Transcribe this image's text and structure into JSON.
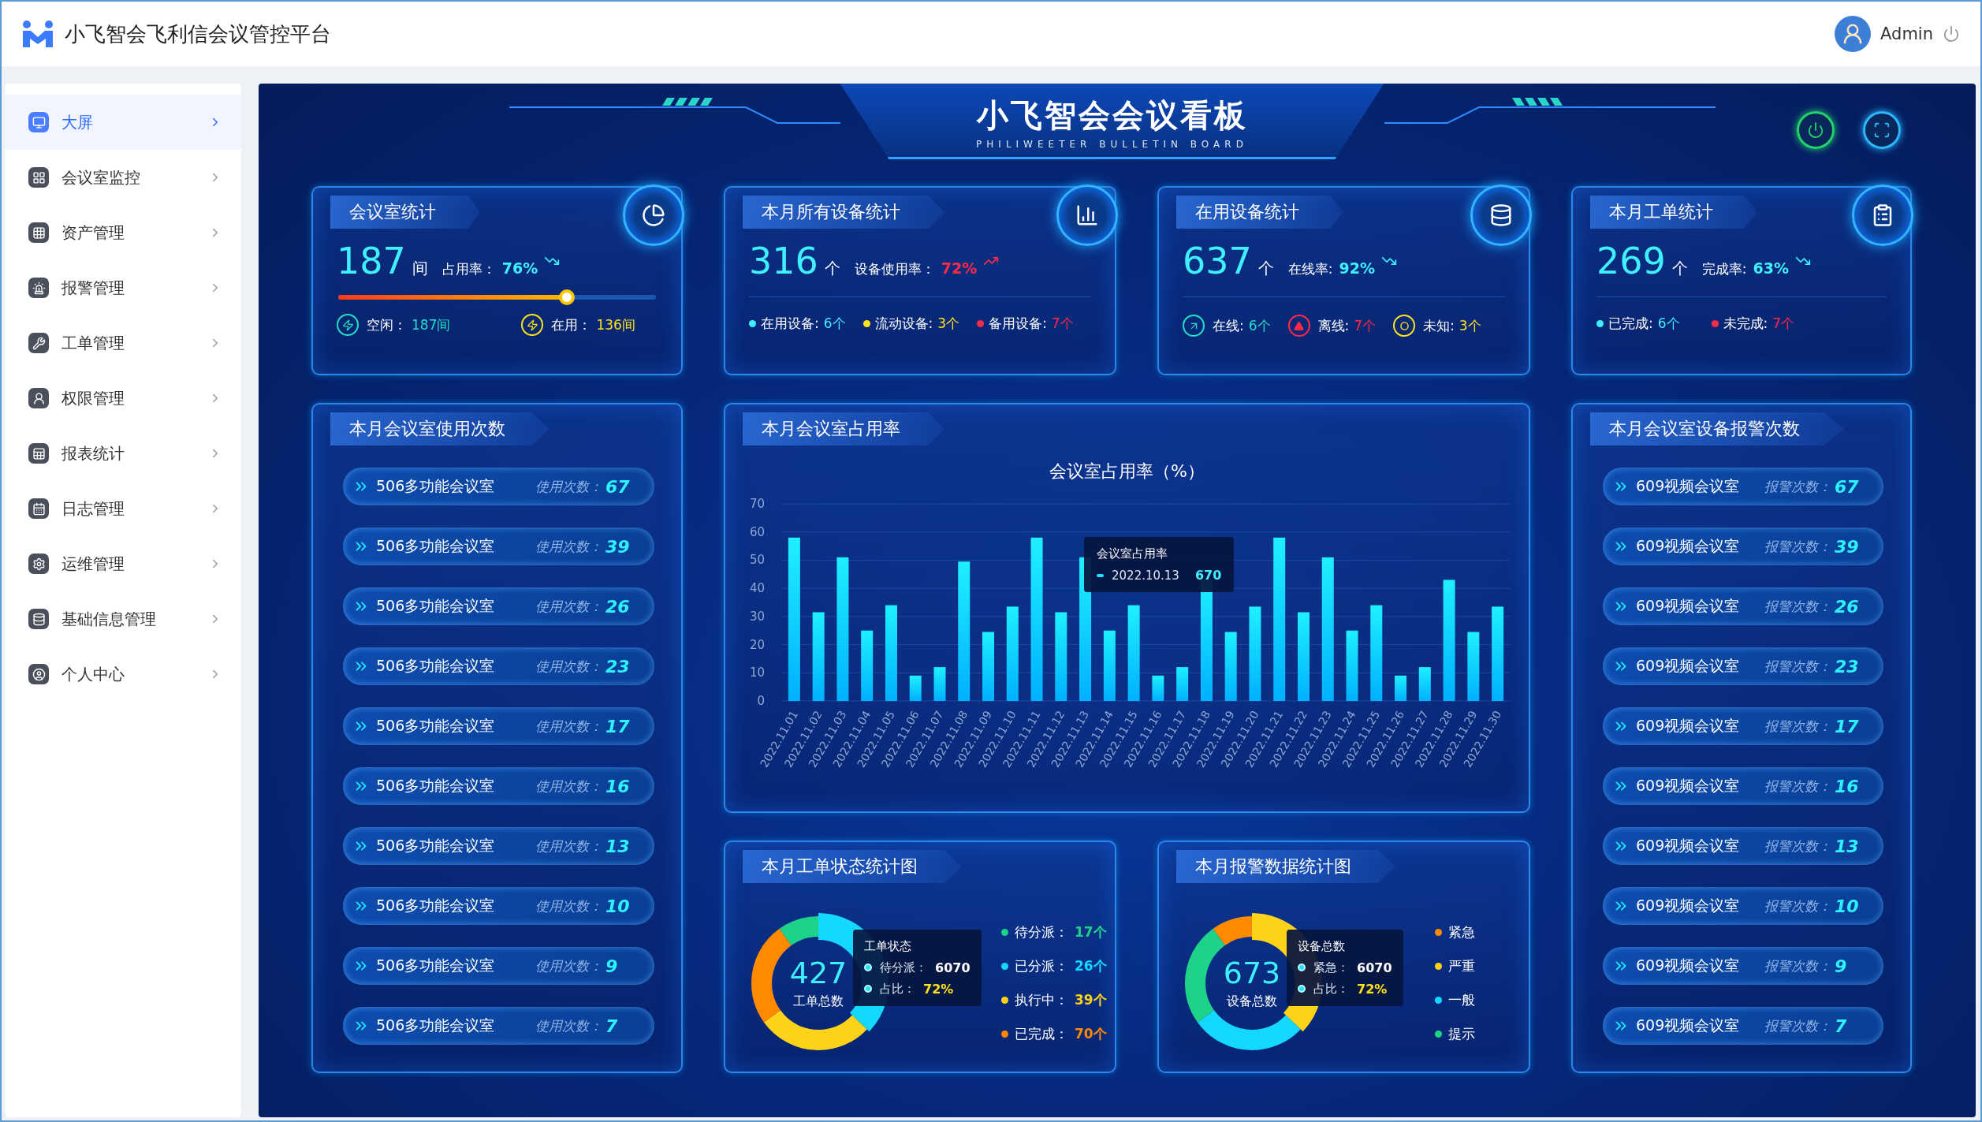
{
  "header": {
    "title": "小飞智会飞利信会议管控平台",
    "user": "Admin"
  },
  "sidebar": {
    "items": [
      {
        "label": "大屏",
        "selected": true
      },
      {
        "label": "会议室监控",
        "selected": false
      },
      {
        "label": "资产管理",
        "selected": false
      },
      {
        "label": "报警管理",
        "selected": false
      },
      {
        "label": "工单管理",
        "selected": false
      },
      {
        "label": "权限管理",
        "selected": false
      },
      {
        "label": "报表统计",
        "selected": false
      },
      {
        "label": "日志管理",
        "selected": false
      },
      {
        "label": "运维管理",
        "selected": false
      },
      {
        "label": "基础信息管理",
        "selected": false
      },
      {
        "label": "个人中心",
        "selected": false
      }
    ]
  },
  "board": {
    "title": "小飞智会会议看板",
    "subtitle": "PHILIWEETER BULLETIN BOARD"
  },
  "top_cards": [
    {
      "title": "会议室统计",
      "total": "187",
      "unit": "间",
      "rate_label": "占用率：",
      "rate": "76%",
      "rising": false,
      "color": "#3ff0ff",
      "slider": {
        "level": 0.72
      },
      "items": [
        {
          "kind": "bolt",
          "label": "空闲：",
          "value": "187间",
          "color": "#22e0c8"
        },
        {
          "kind": "bolt",
          "label": "在用：",
          "value": "136间",
          "color": "#ffe21a"
        }
      ]
    },
    {
      "title": "本月所有设备统计",
      "total": "316",
      "unit": "个",
      "rate_label": "设备使用率：",
      "rate": "72%",
      "rising": true,
      "color": "#ff2a4a",
      "items": [
        {
          "kind": "dot",
          "label": "在用设备:",
          "value": "6个",
          "color": "#3ff0ff"
        },
        {
          "kind": "dot",
          "label": "流动设备:",
          "value": "3个",
          "color": "#ffe21a"
        },
        {
          "kind": "dot",
          "label": "备用设备:",
          "value": "7个",
          "color": "#ff2a4a"
        }
      ]
    },
    {
      "title": "在用设备统计",
      "total": "637",
      "unit": "个",
      "rate_label": "在线率:",
      "rate": "92%",
      "rising": false,
      "color": "#3ff0ff",
      "items": [
        {
          "kind": "online",
          "label": "在线:",
          "value": "6个",
          "color": "#22e0c8"
        },
        {
          "kind": "offline",
          "label": "离线:",
          "value": "7个",
          "color": "#ff2a4a"
        },
        {
          "kind": "unknown",
          "label": "未知:",
          "value": "3个",
          "color": "#ffe21a"
        }
      ]
    },
    {
      "title": "本月工单统计",
      "total": "269",
      "unit": "个",
      "rate_label": "完成率:",
      "rate": "63%",
      "rising": false,
      "color": "#3ff0ff",
      "items": [
        {
          "kind": "dot",
          "label": "已完成:",
          "value": "6个",
          "color": "#3ff0ff"
        },
        {
          "kind": "dot",
          "label": "未完成:",
          "value": "7个",
          "color": "#ff2a4a"
        }
      ]
    }
  ],
  "usage_list": {
    "title": "本月会议室使用次数",
    "items": [
      {
        "name": "506多功能会议室",
        "label": "使用次数：",
        "count": "67"
      },
      {
        "name": "506多功能会议室",
        "label": "使用次数：",
        "count": "39"
      },
      {
        "name": "506多功能会议室",
        "label": "使用次数：",
        "count": "26"
      },
      {
        "name": "506多功能会议室",
        "label": "使用次数：",
        "count": "23"
      },
      {
        "name": "506多功能会议室",
        "label": "使用次数：",
        "count": "17"
      },
      {
        "name": "506多功能会议室",
        "label": "使用次数：",
        "count": "16"
      },
      {
        "name": "506多功能会议室",
        "label": "使用次数：",
        "count": "13"
      },
      {
        "name": "506多功能会议室",
        "label": "使用次数：",
        "count": "10"
      },
      {
        "name": "506多功能会议室",
        "label": "使用次数：",
        "count": "9"
      },
      {
        "name": "506多功能会议室",
        "label": "使用次数：",
        "count": "7"
      }
    ]
  },
  "occupancy": {
    "title": "本月会议室占用率",
    "chart_data": {
      "type": "bar",
      "title": "会议室占用率（%）",
      "categories": [
        "2022.11.01",
        "2022.11.02",
        "2022.11.03",
        "2022.11.04",
        "2022.11.05",
        "2022.11.06",
        "2022.11.07",
        "2022.11.08",
        "2022.11.09",
        "2022.11.10",
        "2022.11.11",
        "2022.11.12",
        "2022.11.13",
        "2022.11.14",
        "2022.11.15",
        "2022.11.16",
        "2022.11.17",
        "2022.11.18",
        "2022.11.19",
        "2022.11.20",
        "2022.11.21",
        "2022.11.22",
        "2022.11.23",
        "2022.11.24",
        "2022.11.25",
        "2022.11.26",
        "2022.11.27",
        "2022.11.28",
        "2022.11.29",
        "2022.11.30"
      ],
      "values": [
        58,
        31.5,
        51,
        25,
        34,
        9,
        12,
        49.5,
        24.5,
        33.5,
        58,
        31.5,
        51,
        25,
        34,
        9,
        12,
        43,
        24.5,
        33.5,
        58,
        31.5,
        51,
        25,
        34,
        9,
        12,
        43,
        24.5,
        33.5
      ],
      "ylim": [
        0,
        70
      ],
      "grid": true,
      "yticks": [
        0,
        10,
        20,
        30,
        40,
        50,
        60,
        70
      ]
    },
    "tooltip": {
      "title": "会议室占用率",
      "date": "2022.10.13",
      "value": "670"
    }
  },
  "alarm_list": {
    "title": "本月会议室设备报警次数",
    "items": [
      {
        "name": "609视频会议室",
        "label": "报警次数：",
        "count": "67"
      },
      {
        "name": "609视频会议室",
        "label": "报警次数：",
        "count": "39"
      },
      {
        "name": "609视频会议室",
        "label": "报警次数：",
        "count": "26"
      },
      {
        "name": "609视频会议室",
        "label": "报警次数：",
        "count": "23"
      },
      {
        "name": "609视频会议室",
        "label": "报警次数：",
        "count": "17"
      },
      {
        "name": "609视频会议室",
        "label": "报警次数：",
        "count": "16"
      },
      {
        "name": "609视频会议室",
        "label": "报警次数：",
        "count": "13"
      },
      {
        "name": "609视频会议室",
        "label": "报警次数：",
        "count": "10"
      },
      {
        "name": "609视频会议室",
        "label": "报警次数：",
        "count": "9"
      },
      {
        "name": "609视频会议室",
        "label": "报警次数：",
        "count": "7"
      }
    ]
  },
  "donut_cards": [
    {
      "title": "本月工单状态统计图",
      "center_value": "427",
      "center_label": "工单总数",
      "tooltip": {
        "title": "工单状态",
        "rows": [
          {
            "label": "待分派：",
            "value": "6070",
            "color": "#ffffff"
          },
          {
            "label": "占比：",
            "value": "72%",
            "color": "#ffe21a"
          }
        ]
      },
      "legend": [
        {
          "label": "待分派：",
          "value": "17个",
          "color": "#1fd28a"
        },
        {
          "label": "已分派：",
          "value": "26个",
          "color": "#14d8ff"
        },
        {
          "label": "执行中：",
          "value": "39个",
          "color": "#ffd21a"
        },
        {
          "label": "已完成：",
          "value": "70个",
          "color": "#ff8a00"
        }
      ]
    },
    {
      "title": "本月报警数据统计图",
      "center_value": "673",
      "center_label": "设备总数",
      "tooltip": {
        "title": "设备总数",
        "rows": [
          {
            "label": "紧急：",
            "value": "6070",
            "color": "#ffffff"
          },
          {
            "label": "占比：",
            "value": "72%",
            "color": "#ffe21a"
          }
        ]
      },
      "legend": [
        {
          "label": "紧急",
          "color": "#ff8a00"
        },
        {
          "label": "严重",
          "color": "#ffd21a"
        },
        {
          "label": "一般",
          "color": "#14d8ff"
        },
        {
          "label": "提示",
          "color": "#1fd28a"
        }
      ]
    }
  ]
}
